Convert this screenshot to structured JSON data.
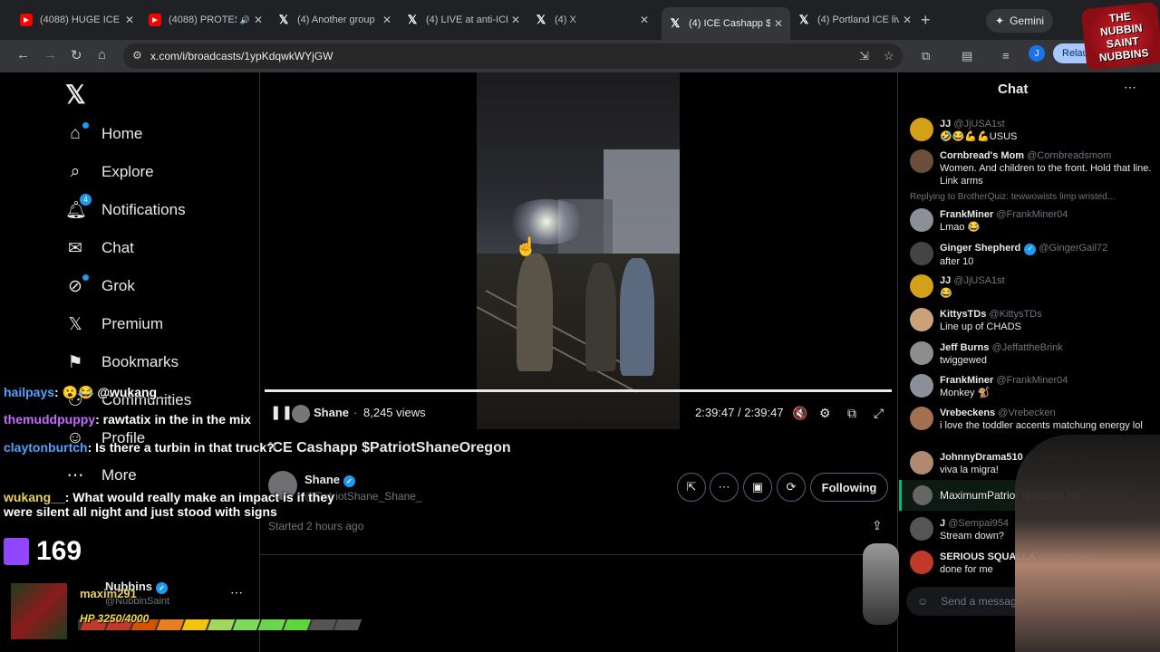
{
  "browser": {
    "tabs": [
      {
        "icon": "youtube",
        "title": "(4088) HUGE ICE P",
        "active": false
      },
      {
        "icon": "youtube",
        "title": "(4088) PROTES",
        "active": false,
        "audio": true
      },
      {
        "icon": "x",
        "title": "(4) Another group",
        "active": false
      },
      {
        "icon": "x",
        "title": "(4) LIVE at anti-ICE",
        "active": false
      },
      {
        "icon": "x",
        "title": "(4) X",
        "active": false
      },
      {
        "icon": "x",
        "title": "(4) ICE Cashapp $P",
        "active": true
      },
      {
        "icon": "x",
        "title": "(4) Portland ICE liv",
        "active": false
      }
    ],
    "gemini_label": "Gemini",
    "url": "x.com/i/broadcasts/1ypKdqwkWYjGW",
    "profile_initial": "J",
    "relaunch_label": "Relaun"
  },
  "nav": {
    "items": [
      {
        "label": "Home",
        "icon": "home-icon"
      },
      {
        "label": "Explore",
        "icon": "search-icon"
      },
      {
        "label": "Notifications",
        "icon": "bell-icon",
        "badge": "4"
      },
      {
        "label": "Chat",
        "icon": "mail-icon"
      },
      {
        "label": "Grok",
        "icon": "grok-icon"
      },
      {
        "label": "Premium",
        "icon": "x-icon"
      },
      {
        "label": "Bookmarks",
        "icon": "bookmark-icon"
      },
      {
        "label": "Communities",
        "icon": "people-icon"
      },
      {
        "label": "Profile",
        "icon": "person-icon"
      },
      {
        "label": "More",
        "icon": "more-icon"
      }
    ],
    "account": {
      "name": "Nubbins",
      "handle": "@NubbinSaint"
    }
  },
  "video": {
    "host": "Shane",
    "views": "8,245 views",
    "time": "2:39:47 / 2:39:47",
    "progress": 1.0,
    "title": "ICE Cashapp $PatriotShaneOregon",
    "host_name": "Shane",
    "host_handle": "@PatriotShane_Shane_",
    "started": "Started 2 hours ago",
    "following_label": "Following"
  },
  "chat": {
    "title": "Chat",
    "reply_note": "Replying to BrotherQuiz: tewwowists limp wristed...",
    "messages": [
      {
        "name": "JJ",
        "handle": "@JjUSA1st",
        "text": "🤣😂💪💪USUS",
        "color": "#d4a017"
      },
      {
        "name": "Cornbread's Mom",
        "handle": "@Cornbreadsmom",
        "text": "Women. And children to the front. Hold that line.  Link arms",
        "color": "#6b4f3a"
      },
      {
        "name": "FrankMiner",
        "handle": "@FrankMiner04",
        "text": "Lmao 😂",
        "color": "#8a8f99"
      },
      {
        "name": "Ginger Shepherd",
        "handle": "@GingerGail72",
        "text": "after 10",
        "color": "#444",
        "verified": true
      },
      {
        "name": "JJ",
        "handle": "@JjUSA1st",
        "text": "😂",
        "color": "#d4a017"
      },
      {
        "name": "KittysTDs",
        "handle": "@KittysTDs",
        "text": "Line up of CHADS",
        "color": "#c9a27a"
      },
      {
        "name": "Jeff Burns",
        "handle": "@JeffattheBrink",
        "text": "twiggewed",
        "color": "#8d8d8d"
      },
      {
        "name": "FrankMiner",
        "handle": "@FrankMiner04",
        "text": "Monkey 🐒",
        "color": "#8a8f99"
      },
      {
        "name": "Vrebeckens",
        "handle": "@Vrebecken",
        "text": "i love the toddler accents matchung energy lol",
        "color": "#a07050"
      },
      {
        "name": "JohnnyDrama510",
        "handle": "@Drama2150",
        "text": "viva la migra!",
        "color": "#b08a70"
      }
    ],
    "repost_text": "MaximumPatriot reposted the",
    "messages2": [
      {
        "name": "J",
        "handle": "@Sempai954",
        "text": "Stream down?",
        "color": "#555"
      },
      {
        "name": "SERIOUS SQUALLA",
        "handle": "@JamieBarn",
        "text": "done for me",
        "color": "#c0392b"
      }
    ],
    "send_placeholder": "Send a message"
  },
  "overlay": {
    "chat_lines": [
      {
        "name": "hailpays",
        "text": ": 😮😂 @wukang__"
      },
      {
        "name": "themuddpuppy",
        "text": ": rawtatix in the in the mix"
      },
      {
        "name": "claytonburtch",
        "text": ": Is there a turbin in that truck?"
      },
      {
        "name": "wukang__",
        "text": ": What would really make an impact is if they were silent all night and just stood with signs"
      }
    ],
    "viewer_count": "169",
    "game_name": "maxim291",
    "hp_text": "HP 3250/4000",
    "hp_fraction": 0.8125,
    "logo_text": "THE NUBBIN SAINT NUBBINS SHOW"
  }
}
